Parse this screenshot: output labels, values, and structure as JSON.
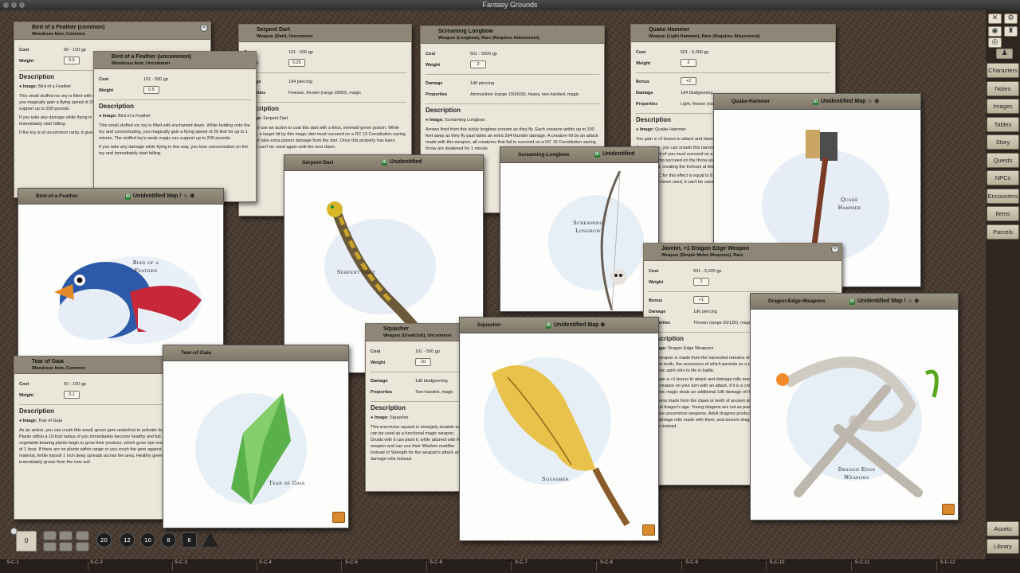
{
  "app": {
    "title": "Fantasy Grounds"
  },
  "sidebar": {
    "tools": [
      "✕",
      "⚙",
      "◉",
      "♜"
    ],
    "buttons": [
      "Characters",
      "Notes",
      "Images",
      "Tables",
      "Story",
      "Quests",
      "NPCs",
      "Encounters",
      "Items",
      "Parcels"
    ],
    "bottom_buttons": [
      "Assets",
      "Library"
    ]
  },
  "hotkeys": [
    "S-C-1",
    "S-C-2",
    "S-C-3",
    "S-C-4",
    "S-C-5",
    "S-C-6",
    "S-C-7",
    "S-C-8",
    "S-C-9",
    "S-C-10",
    "S-C-11",
    "S-C-12"
  ],
  "dice": {
    "chat_value": "0",
    "dice": [
      "20",
      "12",
      "10",
      "8",
      "6"
    ]
  },
  "labels": {
    "cost": "Cost",
    "weight": "Weight",
    "damage": "Damage",
    "properties": "Properties",
    "bonus": "Bonus",
    "description": "Description",
    "image_prefix": "Image:",
    "unidentified_map": "Unidentified Map",
    "unidentified": "Unidentified"
  },
  "items": {
    "bird_common": {
      "name": "Bird of a Feather (common)",
      "subtitle": "Wondrous Item, Common",
      "cost": "50 - 100 gp",
      "weight": "0.5",
      "image": "Bird of a Feather",
      "paras": [
        "This small stuffed roc toy is filled with enchanted down. While holding the toy and concentrating, you magically gain a flying speed of 20 feet for up to 1 minute. The stuffed toy's weak magic can support up to 200 pounds.",
        "If you take any damage while flying in this way, you lose concentration on the toy and immediately start falling.",
        "If the toy is of uncommon rarity, it gives a happy little chirp when used."
      ]
    },
    "bird_uncommon": {
      "name": "Bird of a Feather (uncommon)",
      "subtitle": "Wondrous Item, Uncommon",
      "cost": "101 - 500 gp",
      "weight": "0.5",
      "image": "Bird of a Feather",
      "paras": [
        "This small stuffed roc toy is filled with enchanted down. While holding onto the toy and concentrating, you magically gain a flying speed of 20 feet for up to 1 minute. The stuffed toy's weak magic can support up to 200 pounds.",
        "If you take any damage while flying in this way, you lose concentration on the toy and immediately start falling."
      ]
    },
    "serpent_dart": {
      "name": "Serpent Dart",
      "subtitle": "Weapon (Dart), Uncommon",
      "cost": "101 - 500 gp",
      "weight": "0.25",
      "damage": "1d4 piercing",
      "properties": "Finesse, thrown (range 20/60), magic",
      "image": "Serpent Dart",
      "paras": [
        "You can use an action to coat this dart with a thick, emerald green poison. While coated, a target hit by this magic dart must succeed on a DC 13 Constitution saving throw or take extra poison damage from the dart. Once this property has been used, it can't be used again until the next dawn."
      ]
    },
    "screaming_longbow": {
      "name": "Screaming Longbow",
      "subtitle": "Weapon (Longbow), Rare (Requires Attunement)",
      "cost": "501 - 5000 gp",
      "weight": "2",
      "damage": "1d8 piercing",
      "properties": "Ammunition (range 150/600), heavy, two-handed, magic",
      "image": "Screaming Longbow",
      "paras": [
        "Arrows fired from this sickly longbow scream as they fly. Each creature within up to 100 feet away as they fly past takes an extra 2d4 thunder damage. A creature hit by an attack made with this weapon, all creatures that fail to succeed on a DC 15 Constitution saving throw are deafened for 1 minute."
      ]
    },
    "quake_hammer": {
      "name": "Quake Hammer",
      "subtitle": "Weapon (Light Hammer), Rare (Requires Attunement)",
      "cost": "501 - 5,000 gp",
      "weight": "2",
      "bonus": "+2",
      "damage": "1d4 bludgeoning",
      "properties": "Light, thrown (range 20/60)",
      "image": "Quake Hammer",
      "paras": [
        "You gain a +2 bonus to attack and damage rolls made with this magic weapon.",
        "As an action, you can smash this hammer into the ground to send out tremors. Other creatures within 15 feet of you must succeed on a DC 14 Dexterity saving throw or suffer the effects. Creatures who succeed on the throw are knocked prone. You can cause this effect to occur once, recharging it, creating the tremors at the point of impact.",
        "The save DC for this effect is equal to 8 + your proficiency bonus + your Strength modifier. Once this property has been used, it can't be used again until the following dawn."
      ]
    },
    "javelin": {
      "name": "Javelin, +1 Dragon Edge Weapon",
      "subtitle": "Weapon (Simple Melee Weapons), Rare",
      "cost": "501 - 5,000 gp",
      "weight": "2",
      "bonus": "+1",
      "damage": "1d6 piercing",
      "properties": "Thrown (range 30/120), magic",
      "image": "Dragon Edge Weapons",
      "paras": [
        "This weapon is made from the harvested remains of a dragon, typically a properly reclaimed claw or tooth, the resonance of which persists as a piercing or slashing weapon whose latent draconic spirit stirs to life in battle.",
        "You gain a +1 bonus to attack and damage rolls made with this magic weapon. The first time you hit a creature on your turn with an attack, if it is a creature that you had advantage on, its draconic magic deals an additional 1d6 damage of the original dragon's element.",
        "Weapons made from the claws or teeth of ancient dragons carry greater power depending on the original dragon's age. Young dragons are not as powerful as older ones, and ancient dragons produce uncommon weapons. Adult dragons produce rare weapons with a +1 bonus to attack and damage rolls made with them, and ancient dragons can create very rare weapons with a +2 bonus instead."
      ]
    },
    "squasher": {
      "name": "Squasher",
      "subtitle": "Weapon (Greatclub), Uncommon",
      "cost": "101 - 500 gp",
      "weight": "10",
      "damage": "1d8 bludgeoning",
      "properties": "Two-handed, magic",
      "image": "Squasher",
      "paras": [
        "This enormous squash is strangely durable and can be used as a functional magic weapon. Druids with it can plant it; while attuned with the weapon and can use their Wisdom modifier instead of Strength for the weapon's attack and damage rolls instead."
      ]
    },
    "tear_of_gaia": {
      "name": "Tear of Gaia",
      "subtitle": "Wondrous Item, Common",
      "cost": "50 - 100 gp",
      "weight": "0.1",
      "image": "Tear of Gaia",
      "paras": [
        "As an action, you can crush this small, green gem underfoot to activate its magic. Plants within a 10-foot radius of you immediately become healthy and full. Fruit and vegetable-bearing plants begin to grow their produce, which grow ripe over the course of 1 hour. If there are no plants within range or you crush the gem against an inorganic material, fertile topsoil 1 inch deep spreads across the area. Healthy green grass immediately grows from the new soil."
      ]
    }
  },
  "maps": {
    "bird": {
      "title": "Bird-of-a-Feather",
      "caption": "Bird of a Feather"
    },
    "serpent": {
      "title": "Serpent-Dart",
      "caption": "Serpent Dart"
    },
    "longbow": {
      "title": "Screaming-Longbow",
      "caption": "Screaming Longbow"
    },
    "quake": {
      "title": "Quake-Hammer",
      "caption": "Quake Hammer"
    },
    "dragon": {
      "title": "Dragon-Edge-Weapons",
      "caption": "Dragon Edge Weapons"
    },
    "squasher": {
      "title": "Squasher",
      "caption": "Squasher"
    },
    "tear": {
      "title": "Tear-of-Gaia",
      "caption": "Tear of Gaia"
    }
  }
}
